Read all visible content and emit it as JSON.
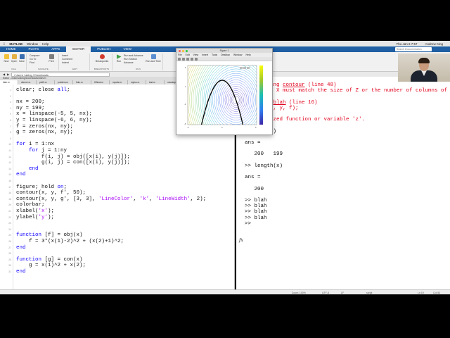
{
  "os_menubar": {
    "app": "MATLAB",
    "items": [
      "Window",
      "Help"
    ],
    "clock": "Thu Jan 6 7:57",
    "user": "Andrew King"
  },
  "toolstrip_tabs": {
    "tabs": [
      "HOME",
      "PLOTS",
      "APPS",
      "EDITOR",
      "PUBLISH",
      "VIEW"
    ],
    "active": "EDITOR",
    "search_placeholder": "Search Documentation"
  },
  "toolstrip": {
    "groups": [
      {
        "name": "FILE",
        "buttons": [
          "New",
          "Open",
          "Save"
        ]
      },
      {
        "name": "NAVIGATE",
        "buttons": [
          "Compare",
          "Go To",
          "Find",
          "Print"
        ]
      },
      {
        "name": "EDIT",
        "buttons": [
          "Insert",
          "Comment",
          "Indent"
        ]
      },
      {
        "name": "BREAKPOINTS",
        "buttons": [
          "Breakpoints"
        ]
      },
      {
        "name": "RUN",
        "buttons": [
          "Run",
          "Run and Advance",
          "Run Section",
          "Advance",
          "Run and Time"
        ]
      }
    ]
  },
  "address_bar": {
    "path": "/ Users / aking / Downloads",
    "editor_title": "Editor - /Users/aking/Downloads/blah.m"
  },
  "editor": {
    "doc_tabs": [
      "blah.m",
      "demo1.m",
      "plot2.m",
      "problem.m",
      "fmin.m",
      "HWsol.m",
      "myode.m",
      "myfun.m",
      "test.m",
      "newstep.m",
      "testing.m",
      "step2.m"
    ],
    "active_tab": "blah.m",
    "lines": [
      {
        "n": "1",
        "segments": [
          {
            "t": "clear; close ",
            "c": ""
          },
          {
            "t": "all",
            "c": "kw"
          },
          {
            "t": ";",
            "c": ""
          }
        ]
      },
      {
        "n": "2",
        "segments": [
          {
            "t": "",
            "c": ""
          }
        ]
      },
      {
        "n": "3",
        "segments": [
          {
            "t": "nx = 200;",
            "c": ""
          }
        ]
      },
      {
        "n": "4",
        "segments": [
          {
            "t": "ny = 199;",
            "c": ""
          }
        ]
      },
      {
        "n": "5",
        "segments": [
          {
            "t": "x = linspace(-5, 5, nx);",
            "c": ""
          }
        ]
      },
      {
        "n": "6",
        "segments": [
          {
            "t": "y = linspace(-6, 6, ny);",
            "c": ""
          }
        ]
      },
      {
        "n": "7",
        "segments": [
          {
            "t": "f = zeros(nx, ny);",
            "c": ""
          }
        ]
      },
      {
        "n": "8",
        "segments": [
          {
            "t": "g = zeros(nx, ny);",
            "c": ""
          }
        ]
      },
      {
        "n": "9",
        "segments": [
          {
            "t": "",
            "c": ""
          }
        ]
      },
      {
        "n": "10",
        "segments": [
          {
            "t": "for",
            "c": "kw"
          },
          {
            "t": " i = 1:nx",
            "c": ""
          }
        ]
      },
      {
        "n": "11",
        "segments": [
          {
            "t": "    ",
            "c": ""
          },
          {
            "t": "for",
            "c": "kw"
          },
          {
            "t": " j = 1:ny",
            "c": ""
          }
        ]
      },
      {
        "n": "12",
        "segments": [
          {
            "t": "        f(i, j) = obj([x(i), y(j)]);",
            "c": ""
          }
        ]
      },
      {
        "n": "13",
        "segments": [
          {
            "t": "        g(i, j) = con([x(i), y(j)]);",
            "c": ""
          }
        ]
      },
      {
        "n": "14",
        "segments": [
          {
            "t": "    ",
            "c": ""
          },
          {
            "t": "end",
            "c": "kw"
          }
        ]
      },
      {
        "n": "15",
        "segments": [
          {
            "t": "end",
            "c": "kw"
          }
        ]
      },
      {
        "n": "16",
        "segments": [
          {
            "t": "",
            "c": ""
          }
        ]
      },
      {
        "n": "17",
        "segments": [
          {
            "t": "figure; hold ",
            "c": ""
          },
          {
            "t": "on",
            "c": "kw"
          },
          {
            "t": ";",
            "c": ""
          }
        ]
      },
      {
        "n": "18",
        "segments": [
          {
            "t": "contour(x, y, f', 50);",
            "c": ""
          }
        ]
      },
      {
        "n": "19",
        "segments": [
          {
            "t": "contour(x, y, g', [3, 3], ",
            "c": ""
          },
          {
            "t": "'LineColor'",
            "c": "str"
          },
          {
            "t": ", ",
            "c": ""
          },
          {
            "t": "'k'",
            "c": "str"
          },
          {
            "t": ", ",
            "c": ""
          },
          {
            "t": "'LineWidth'",
            "c": "str"
          },
          {
            "t": ", 2);",
            "c": ""
          }
        ]
      },
      {
        "n": "20",
        "segments": [
          {
            "t": "colorbar;",
            "c": ""
          }
        ]
      },
      {
        "n": "21",
        "segments": [
          {
            "t": "xlabel(",
            "c": ""
          },
          {
            "t": "'x'",
            "c": "str"
          },
          {
            "t": ");",
            "c": ""
          }
        ]
      },
      {
        "n": "22",
        "segments": [
          {
            "t": "ylabel(",
            "c": ""
          },
          {
            "t": "'y'",
            "c": "str"
          },
          {
            "t": ");",
            "c": ""
          }
        ]
      },
      {
        "n": "23",
        "segments": [
          {
            "t": "",
            "c": ""
          }
        ]
      },
      {
        "n": "24",
        "segments": [
          {
            "t": "",
            "c": ""
          }
        ]
      },
      {
        "n": "25",
        "segments": [
          {
            "t": "function",
            "c": "kw"
          },
          {
            "t": " [f] = obj(x)",
            "c": ""
          }
        ]
      },
      {
        "n": "26",
        "segments": [
          {
            "t": "    f = 3*(x(1)-2)^2 + (x(2)+1)^2;",
            "c": ""
          }
        ]
      },
      {
        "n": "27",
        "segments": [
          {
            "t": "end",
            "c": "kw"
          }
        ]
      },
      {
        "n": "28",
        "segments": [
          {
            "t": "",
            "c": ""
          }
        ]
      },
      {
        "n": "29",
        "segments": [
          {
            "t": "function",
            "c": "kw"
          },
          {
            "t": " [g] = con(x)",
            "c": ""
          }
        ]
      },
      {
        "n": "30",
        "segments": [
          {
            "t": "    g = x(1)^2 + x(2);",
            "c": ""
          }
        ]
      },
      {
        "n": "31",
        "segments": [
          {
            "t": "end",
            "c": "kw"
          }
        ]
      }
    ]
  },
  "command_window": {
    "title": "Command Window",
    "lines": [
      {
        "segments": [
          {
            "t": "Error using ",
            "c": "err"
          },
          {
            "t": "contour",
            "c": "link"
          },
          {
            "t": " (line 48)",
            "c": "err"
          }
        ]
      },
      {
        "segments": [
          {
            "t": "Length of X must match the size of Z or the number of columns of Z.",
            "c": "err"
          }
        ]
      },
      {
        "segments": [
          {
            "t": "",
            "c": ""
          }
        ]
      },
      {
        "segments": [
          {
            "t": "Error in ",
            "c": "err"
          },
          {
            "t": "blah",
            "c": "link"
          },
          {
            "t": " (line 16)",
            "c": "err"
          }
        ]
      },
      {
        "segments": [
          {
            "t": "contour(x, y, f);",
            "c": "err"
          }
        ]
      },
      {
        "segments": [
          {
            "t": "",
            "c": ""
          }
        ]
      },
      {
        "segments": [
          {
            "t": "Unrecognized function or variable 'z'.",
            "c": "err"
          }
        ]
      },
      {
        "segments": [
          {
            "t": "",
            "c": ""
          }
        ]
      },
      {
        "segments": [
          {
            "t": ">> size(f)",
            "c": ""
          }
        ]
      },
      {
        "segments": [
          {
            "t": "",
            "c": ""
          }
        ]
      },
      {
        "segments": [
          {
            "t": "ans =",
            "c": ""
          }
        ]
      },
      {
        "segments": [
          {
            "t": "",
            "c": ""
          }
        ]
      },
      {
        "segments": [
          {
            "t": "   200   199",
            "c": ""
          }
        ]
      },
      {
        "segments": [
          {
            "t": "",
            "c": ""
          }
        ]
      },
      {
        "segments": [
          {
            "t": ">> length(x)",
            "c": ""
          }
        ]
      },
      {
        "segments": [
          {
            "t": "",
            "c": ""
          }
        ]
      },
      {
        "segments": [
          {
            "t": "ans =",
            "c": ""
          }
        ]
      },
      {
        "segments": [
          {
            "t": "",
            "c": ""
          }
        ]
      },
      {
        "segments": [
          {
            "t": "   200",
            "c": ""
          }
        ]
      },
      {
        "segments": [
          {
            "t": "",
            "c": ""
          }
        ]
      },
      {
        "segments": [
          {
            "t": ">> blah",
            "c": ""
          }
        ]
      },
      {
        "segments": [
          {
            "t": ">> blah",
            "c": ""
          }
        ]
      },
      {
        "segments": [
          {
            "t": ">> blah",
            "c": ""
          }
        ]
      },
      {
        "segments": [
          {
            "t": ">> blah",
            "c": ""
          }
        ]
      },
      {
        "segments": [
          {
            "t": ">> ",
            "c": ""
          }
        ]
      }
    ],
    "fx_label": "fx"
  },
  "status_bar": {
    "zoom": "Zoom: 100%",
    "encoding": "UTF-8",
    "eol": "LF",
    "file_type": "script",
    "ln": "Ln 19",
    "col": "Col 53"
  },
  "figure_window": {
    "title": "Figure 1",
    "menu": [
      "File",
      "Edit",
      "View",
      "Insert",
      "Tools",
      "Desktop",
      "Window",
      "Help"
    ]
  },
  "colors": {
    "toolstrip_blue": "#1f5fa4",
    "keyword": "#0e00ff",
    "string": "#a709f5",
    "error": "#e0001b"
  }
}
